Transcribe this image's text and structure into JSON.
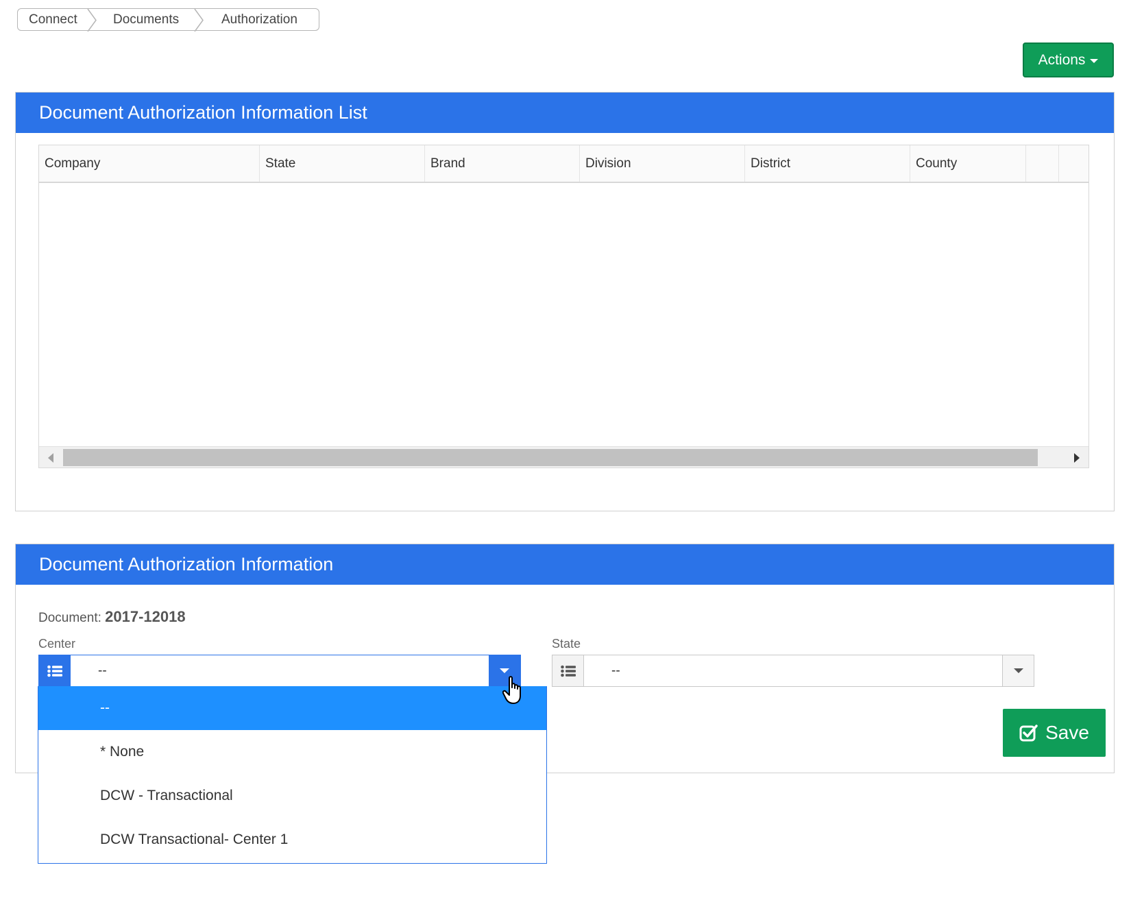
{
  "breadcrumb": {
    "items": [
      "Connect",
      "Documents",
      "Authorization"
    ]
  },
  "actions": {
    "label": "Actions"
  },
  "list_panel": {
    "title": "Document Authorization Information List",
    "columns": [
      "Company",
      "State",
      "Brand",
      "Division",
      "District",
      "County",
      "",
      ""
    ]
  },
  "info_panel": {
    "title": "Document Authorization Information",
    "document_label": "Document:",
    "document_value": "2017-12018",
    "center": {
      "label": "Center",
      "value": "--",
      "options": [
        "--",
        "* None",
        "DCW - Transactional",
        "DCW Transactional- Center 1"
      ],
      "selected_index": 0
    },
    "state": {
      "label": "State",
      "value": "--"
    },
    "save_label": "Save"
  },
  "colors": {
    "header_blue": "#2b73e8",
    "selected_blue": "#1e90ff",
    "green": "#0f9d58"
  }
}
